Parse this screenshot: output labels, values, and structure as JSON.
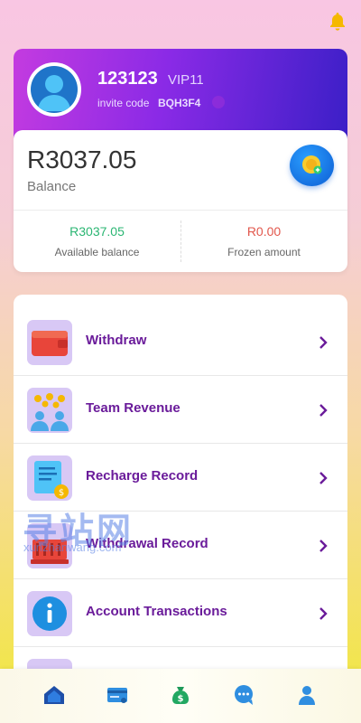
{
  "profile": {
    "username": "123123",
    "vip": "VIP11",
    "invite_label": "invite code",
    "invite_code": "BQH3F4"
  },
  "balance": {
    "amount": "R3037.05",
    "label": "Balance",
    "available_value": "R3037.05",
    "available_label": "Available balance",
    "frozen_value": "R0.00",
    "frozen_label": "Frozen amount"
  },
  "menu": {
    "items": [
      {
        "label": "Withdraw",
        "icon": "wallet-icon"
      },
      {
        "label": "Team Revenue",
        "icon": "team-icon"
      },
      {
        "label": "Recharge Record",
        "icon": "receipt-icon"
      },
      {
        "label": "Withdrawal Record",
        "icon": "cash-register-icon"
      },
      {
        "label": "Account Transactions",
        "icon": "info-icon"
      }
    ]
  },
  "watermark": {
    "line1": "寻站网",
    "line2": "xunzhanwang.com"
  },
  "nav": {
    "items": [
      "home-icon",
      "card-icon",
      "money-bag-icon",
      "chat-icon",
      "profile-icon"
    ]
  },
  "colors": {
    "accent_purple": "#6a1b9a",
    "available_green": "#2bb673",
    "frozen_red": "#e2574c",
    "bell_yellow": "#f5b800"
  }
}
